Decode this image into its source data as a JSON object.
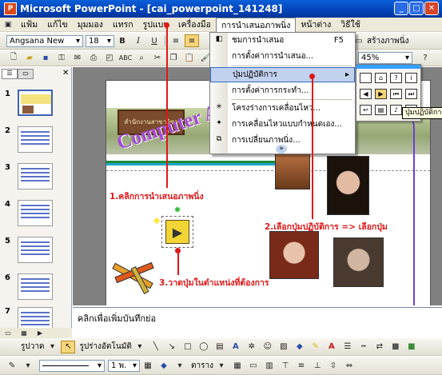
{
  "window": {
    "title": "Microsoft PowerPoint - [cai_powerpoint_141248]"
  },
  "menubar": {
    "items": [
      "แฟ้ม",
      "แก้ไข",
      "มุมมอง",
      "แทรก",
      "รูปแบบ",
      "เครื่องมือ",
      "การนำเสนอภาพนิ่ง",
      "หน้าต่าง",
      "วิธีใช้"
    ],
    "active": "การนำเสนอภาพนิ่ง"
  },
  "format_toolbar": {
    "font": "Angsana New",
    "size": "18",
    "bold": "B",
    "italic": "I",
    "underline": "U",
    "right_label": "สร้างภาพนิ่ง"
  },
  "std_toolbar": {
    "zoom": "45%"
  },
  "dropdown": {
    "items": [
      {
        "label": "ชมการนำเสนอ",
        "shortcut": "F5"
      },
      {
        "label": "การตั้งค่าการนำเสนอ..."
      },
      {
        "label": "ปุ่มปฏิบัติการ",
        "has_submenu": true
      },
      {
        "label": "การตั้งค่าการกระทำ..."
      },
      {
        "label": "โครงร่างการเคลื่อนไหว..."
      },
      {
        "label": "การเคลื่อนไหวแบบกำหนดเอง..."
      },
      {
        "label": "การเปลี่ยนภาพนิ่ง..."
      }
    ],
    "expand": "»"
  },
  "tooltip": "ปุ่มปฏิบัติการ: ไปข้",
  "slide": {
    "banner": "Computer Assisted Instruction",
    "signboard": "สำนักงานสาขาวิชาวิทยาศาสตร์",
    "step1": "1.คลิกการนำเสนอภาพนิ่ง",
    "step2": "2.เลือกปุ่มปฏิบัติการ => เลือกปุ่ม",
    "step3": "3.วาดปุ่มในตำแหน่งที่ต้องการ"
  },
  "slides_panel": {
    "numbers": [
      "1",
      "2",
      "3",
      "4",
      "5",
      "6",
      "7"
    ]
  },
  "notes": {
    "placeholder": "คลิกเพื่อเพิ่มบันทึกย่อ"
  },
  "draw_toolbar": {
    "draw": "รูปวาด",
    "autoshapes": "รูปร่างอัตโนมัติ",
    "line_width": "1 พ.",
    "table": "ตาราง"
  },
  "colors": {
    "accent": "#e01818",
    "menu_highlight": "#c1d2ee",
    "banner": "#a54ad6"
  }
}
